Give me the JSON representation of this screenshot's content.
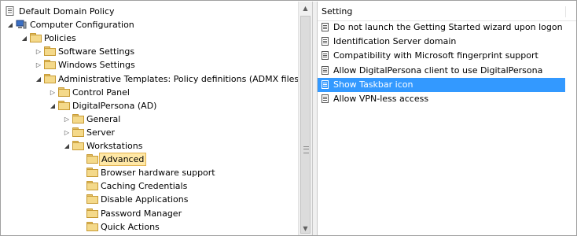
{
  "tree": [
    {
      "label": "Default Domain Policy",
      "level": 0,
      "expander": "",
      "icon": "policy-icon"
    },
    {
      "label": "Computer Configuration",
      "level": 1,
      "expander": "expanded",
      "icon": "computer-icon"
    },
    {
      "label": "Policies",
      "level": 2,
      "expander": "expanded",
      "icon": "folder-icon"
    },
    {
      "label": "Software Settings",
      "level": 3,
      "expander": "collapsed",
      "icon": "folder-icon"
    },
    {
      "label": "Windows Settings",
      "level": 3,
      "expander": "collapsed",
      "icon": "folder-icon"
    },
    {
      "label": "Administrative Templates: Policy definitions (ADMX files)",
      "level": 3,
      "expander": "expanded",
      "icon": "folder-icon"
    },
    {
      "label": "Control Panel",
      "level": 4,
      "expander": "collapsed",
      "icon": "folder-icon"
    },
    {
      "label": "DigitalPersona (AD)",
      "level": 4,
      "expander": "expanded",
      "icon": "folder-icon"
    },
    {
      "label": "General",
      "level": 5,
      "expander": "collapsed",
      "icon": "folder-icon"
    },
    {
      "label": "Server",
      "level": 5,
      "expander": "collapsed",
      "icon": "folder-icon"
    },
    {
      "label": "Workstations",
      "level": 5,
      "expander": "expanded",
      "icon": "folder-icon"
    },
    {
      "label": "Advanced",
      "level": 6,
      "expander": "",
      "icon": "folder-icon",
      "selected": true
    },
    {
      "label": "Browser hardware support",
      "level": 6,
      "expander": "",
      "icon": "folder-icon"
    },
    {
      "label": "Caching Credentials",
      "level": 6,
      "expander": "",
      "icon": "folder-icon"
    },
    {
      "label": "Disable Applications",
      "level": 6,
      "expander": "",
      "icon": "folder-icon"
    },
    {
      "label": "Password Manager",
      "level": 6,
      "expander": "",
      "icon": "folder-icon"
    },
    {
      "label": "Quick Actions",
      "level": 6,
      "expander": "",
      "icon": "folder-icon"
    }
  ],
  "settings_pane": {
    "column_header": "Setting",
    "items": [
      {
        "label": "Do not launch the Getting Started wizard upon logon",
        "selected": false
      },
      {
        "label": "Identification Server domain",
        "selected": false
      },
      {
        "label": "Compatibility with Microsoft fingerprint support",
        "selected": false
      },
      {
        "label": "Allow DigitalPersona client to use DigitalPersona Server",
        "selected": false
      },
      {
        "label": "Show Taskbar icon",
        "selected": true
      },
      {
        "label": "Allow VPN-less access",
        "selected": false
      }
    ]
  },
  "colors": {
    "selection_blue": "#3399ff",
    "tree_selection": "#ffe8a6"
  }
}
